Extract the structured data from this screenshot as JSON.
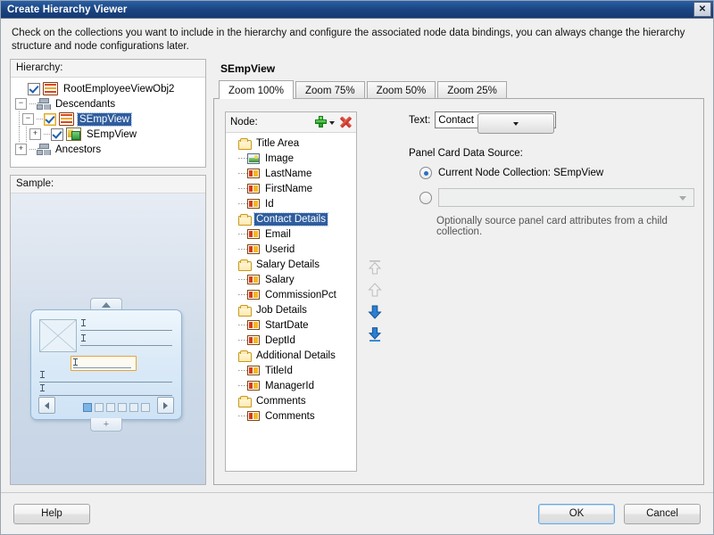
{
  "window": {
    "title": "Create Hierarchy Viewer",
    "close_icon": "close-icon",
    "close_glyph": "✕"
  },
  "instruction": "Check on the collections you want to include in the hierarchy and configure the associated node data bindings, you can always change the hierarchy structure and node configurations later.",
  "hierarchy": {
    "label": "Hierarchy:",
    "label_mnemonic": "c",
    "items": [
      {
        "label": "RootEmployeeViewObj2",
        "depth": 0,
        "icon": "view-object-icon",
        "checked": true,
        "expander": "none",
        "selected": false
      },
      {
        "label": "Descendants",
        "depth": 1,
        "icon": "group-icon",
        "checked": false,
        "expander": "minus",
        "selected": false
      },
      {
        "label": "SEmpView",
        "depth": 2,
        "icon": "view-object-icon",
        "checked": true,
        "expander": "minus",
        "selected": true
      },
      {
        "label": "SEmpView",
        "depth": 3,
        "icon": "accessor-icon",
        "checked": true,
        "expander": "plus",
        "selected": false
      },
      {
        "label": "Ancestors",
        "depth": 1,
        "icon": "group-icon",
        "checked": false,
        "expander": "plus",
        "selected": false
      }
    ]
  },
  "sample": {
    "label": "Sample:",
    "label_mnemonic": "S",
    "page_dots": 6,
    "active_dot": 1
  },
  "panel": {
    "title": "SEmpView",
    "tabs": [
      {
        "label": "Zoom 100%",
        "active": true
      },
      {
        "label": "Zoom 75%",
        "active": false
      },
      {
        "label": "Zoom 50%",
        "active": false
      },
      {
        "label": "Zoom 25%",
        "active": false
      }
    ]
  },
  "node_panel": {
    "label": "Node:",
    "label_mnemonic": "N",
    "add_icon": "add-plus-icon",
    "add_dropdown_icon": "chevron-down-icon",
    "delete_icon": "delete-x-icon",
    "items": [
      {
        "label": "Title Area",
        "type": "folder",
        "selected": false
      },
      {
        "label": "Image",
        "type": "image",
        "selected": false
      },
      {
        "label": "LastName",
        "type": "attribute",
        "selected": false
      },
      {
        "label": "FirstName",
        "type": "attribute",
        "selected": false
      },
      {
        "label": "Id",
        "type": "attribute",
        "selected": false
      },
      {
        "label": "Contact Details",
        "type": "folder",
        "selected": true
      },
      {
        "label": "Email",
        "type": "attribute",
        "selected": false
      },
      {
        "label": "Userid",
        "type": "attribute",
        "selected": false
      },
      {
        "label": "Salary Details",
        "type": "folder",
        "selected": false
      },
      {
        "label": "Salary",
        "type": "attribute",
        "selected": false
      },
      {
        "label": "CommissionPct",
        "type": "attribute",
        "selected": false
      },
      {
        "label": "Job Details",
        "type": "folder",
        "selected": false
      },
      {
        "label": "StartDate",
        "type": "attribute",
        "selected": false
      },
      {
        "label": "DeptId",
        "type": "attribute",
        "selected": false
      },
      {
        "label": "Additional Details",
        "type": "folder",
        "selected": false
      },
      {
        "label": "TitleId",
        "type": "attribute",
        "selected": false
      },
      {
        "label": "ManagerId",
        "type": "attribute",
        "selected": false
      },
      {
        "label": "Comments",
        "type": "folder",
        "selected": false
      },
      {
        "label": "Comments",
        "type": "attribute",
        "selected": false
      }
    ]
  },
  "reorder": {
    "move_to_top_icon": "move-to-top-arrow-icon",
    "move_up_icon": "move-up-arrow-icon",
    "move_down_icon": "move-down-arrow-icon",
    "move_to_bottom_icon": "move-to-bottom-arrow-icon",
    "enabled_color": "#2b7fd4",
    "disabled_color": "#bdbdbd"
  },
  "settings": {
    "text_label": "Text:",
    "text_label_mnemonic": "T",
    "text_value": "Contact Details",
    "data_source_label": "Panel Card Data Source:",
    "radio_current_label": "Current Node Collection: SEmpView",
    "radio_current_selected": true,
    "radio_child_selected": false,
    "child_combo_value": "",
    "hint": "Optionally source panel card attributes from a child collection."
  },
  "footer": {
    "help_label": "Help",
    "help_mnemonic": "H",
    "ok_label": "OK",
    "cancel_label": "Cancel"
  },
  "colors": {
    "titlebar": "#1b4582",
    "selection": "#2f5d9e",
    "dialog_bg": "#f0f0f0",
    "accent_orange": "#e8a33d"
  }
}
